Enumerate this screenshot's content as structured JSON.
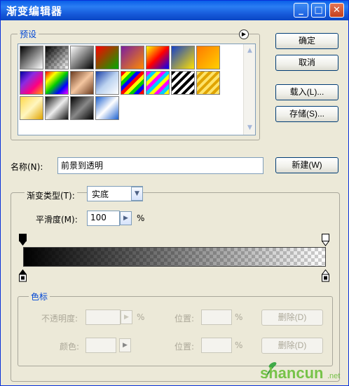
{
  "window": {
    "title": "渐变编辑器",
    "controls": {
      "minimize": "_",
      "maximize": "□",
      "close": "✕"
    }
  },
  "buttons": {
    "ok": "确定",
    "cancel": "取消",
    "load": "载入(L)...",
    "save": "存储(S)...",
    "new": "新建(W)"
  },
  "presets": {
    "legend": "预设",
    "menu_icon": "circle-arrow-icon",
    "swatches": [
      "linear-gradient(135deg,#000,#fff)",
      "linear-gradient(135deg,#000 0%,rgba(0,0,0,0) 100%)",
      "linear-gradient(135deg,#fff,#000)",
      "linear-gradient(135deg,#f00,#0a0)",
      "linear-gradient(135deg,#7a1fa0,#ff8a00)",
      "linear-gradient(135deg,#ff0,#f00 50%,#00f)",
      "linear-gradient(135deg,#1540c8,#ffe000)",
      "linear-gradient(135deg,#ff7a00,#ffd000)",
      "linear-gradient(135deg,#0000a0,#8a2be2,#ff0080,#ffa500)",
      "linear-gradient(135deg,#f00,#ff0,#0c0,#00f,#f0f)",
      "linear-gradient(135deg,#6b3b1f,#f4c6a0,#6b3b1f)",
      "linear-gradient(135deg,#1a3fa8,#bcd3f0 50%,#ffffff)",
      "repeating-linear-gradient(135deg,#f00 0 5px,#ff0 5px 10px,#0c0 10px 15px,#00f 15px 20px)",
      "repeating-linear-gradient(135deg,#f0f 0 5px,#0cf 5px 10px,#ff0 10px 15px)",
      "repeating-linear-gradient(135deg,#000 0 4px,#fff 4px 8px)",
      "repeating-linear-gradient(135deg,#ffe36a 0 4px,#e0a400 4px 8px)",
      "linear-gradient(135deg,#ffd84a,#fff6c0,#e0a400)",
      "linear-gradient(135deg,#111,#eee 50%,#111)",
      "linear-gradient(135deg,#000,#888 50%,#000)",
      "linear-gradient(135deg,#1e62d0,#ffffff 50%,#1e62d0)"
    ]
  },
  "name": {
    "label": "名称(N):",
    "value": "前景到透明"
  },
  "gradient": {
    "type_label": "渐变类型(T):",
    "type_value": "实底",
    "smoothness_label": "平滑度(M):",
    "smoothness_value": "100",
    "percent": "%"
  },
  "stops": {
    "legend": "色标",
    "opacity_label": "不透明度:",
    "opacity_value": "",
    "color_label": "颜色:",
    "location_label": "位置:",
    "location_value": "",
    "percent": "%",
    "delete": "删除(D)"
  },
  "watermark": {
    "logo_text": "shancun.net",
    "brand": "山村"
  }
}
